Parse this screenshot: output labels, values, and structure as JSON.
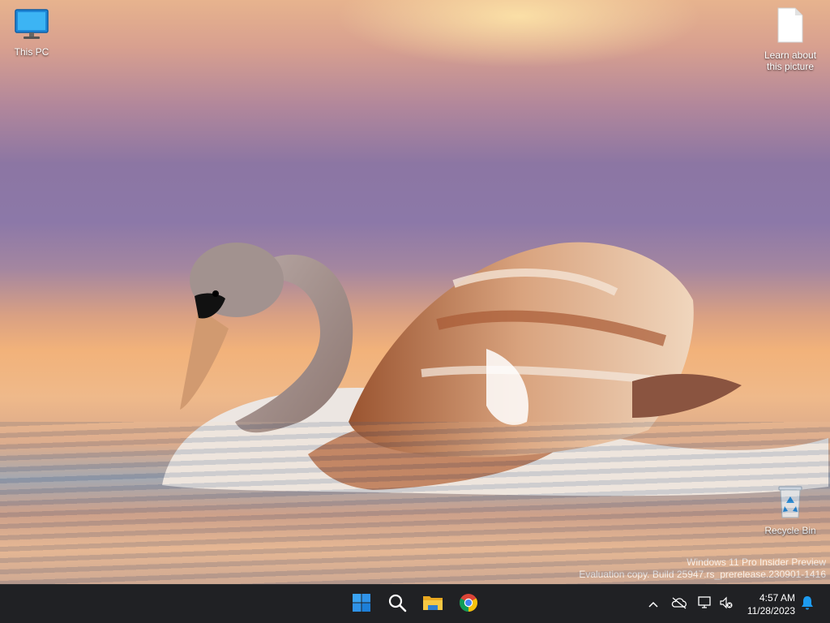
{
  "desktop": {
    "icons": [
      {
        "label": "This PC",
        "icon": "monitor-icon"
      },
      {
        "label": "Learn about this picture",
        "icon": "document-icon"
      },
      {
        "label": "Recycle Bin",
        "icon": "recycle-bin-icon"
      }
    ],
    "watermark": {
      "line1": "Windows 11 Pro Insider Preview",
      "line2": "Evaluation copy. Build 25947.rs_prerelease.230901-1416"
    }
  },
  "taskbar": {
    "apps": [
      {
        "name": "Start",
        "icon": "windows-logo-icon"
      },
      {
        "name": "Search",
        "icon": "search-icon"
      },
      {
        "name": "File Explorer",
        "icon": "folder-icon"
      },
      {
        "name": "Google Chrome",
        "icon": "chrome-icon"
      }
    ],
    "tray": {
      "time": "4:57 AM",
      "date": "11/28/2023",
      "icons": [
        "chevron-up-icon",
        "cloud-off-icon",
        "network-icon",
        "volume-muted-icon",
        "bell-icon"
      ]
    }
  },
  "colors": {
    "taskbar_bg": "#202124",
    "windows_blue": "#1d9bf0"
  }
}
